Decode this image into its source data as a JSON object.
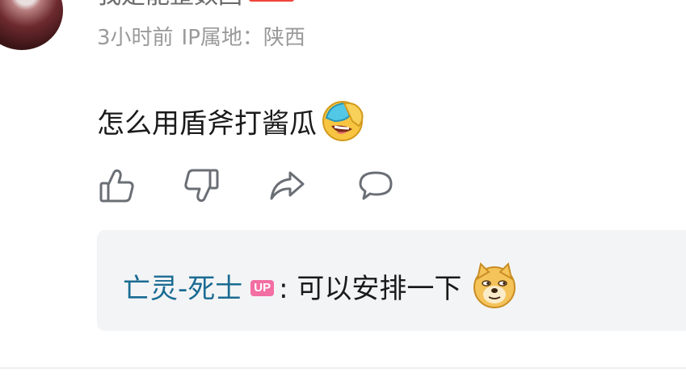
{
  "comment": {
    "username": "我是能整数回",
    "time": "3小时前",
    "ip_location": "IP属地：陕西",
    "text": "怎么用盾斧打酱瓜",
    "text_emoji": "face-cover-laugh-emoji"
  },
  "actions": {
    "like_icon": "thumbs-up-icon",
    "dislike_icon": "thumbs-down-icon",
    "share_icon": "share-arrow-icon",
    "reply_icon": "speech-bubble-icon"
  },
  "reply": {
    "author": "亡灵-死士",
    "badge": "UP",
    "separator": ":",
    "text": "可以安排一下",
    "emoji": "doge-emoji"
  },
  "colors": {
    "link": "#1a6b93",
    "up_badge": "#f26ea3",
    "level_badge": "#f0443a",
    "reply_bg": "#f3f4f6",
    "meta_text": "#9a9a9a"
  }
}
